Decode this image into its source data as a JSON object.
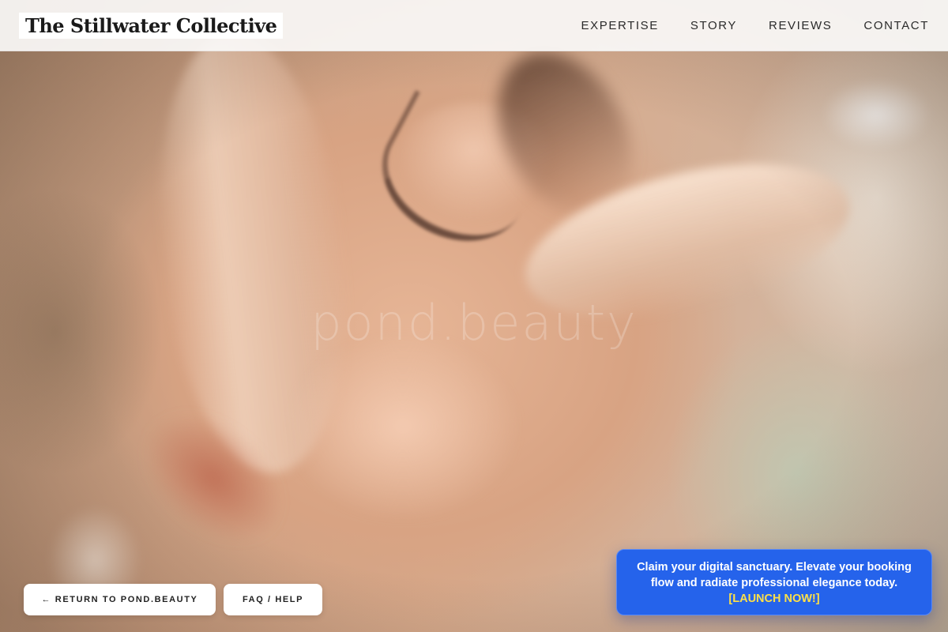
{
  "site": {
    "logo_text": "The Stillwater Collective"
  },
  "nav": {
    "items": [
      {
        "label": "EXPERTISE"
      },
      {
        "label": "STORY"
      },
      {
        "label": "REVIEWS"
      },
      {
        "label": "CONTACT"
      }
    ]
  },
  "hero": {
    "watermark": "pond.beauty",
    "image_subject": "close-up of a face with closed eyes and fingers touching the skin"
  },
  "footer_buttons": {
    "return_label": "← RETURN TO POND.BEAUTY",
    "faq_label": "FAQ / HELP"
  },
  "promo": {
    "text": "Claim your digital sanctuary. Elevate your booking flow and radiate professional elegance today.",
    "cta": "[LAUNCH NOW!]",
    "background_color": "#2563eb",
    "cta_color": "#fde047"
  }
}
